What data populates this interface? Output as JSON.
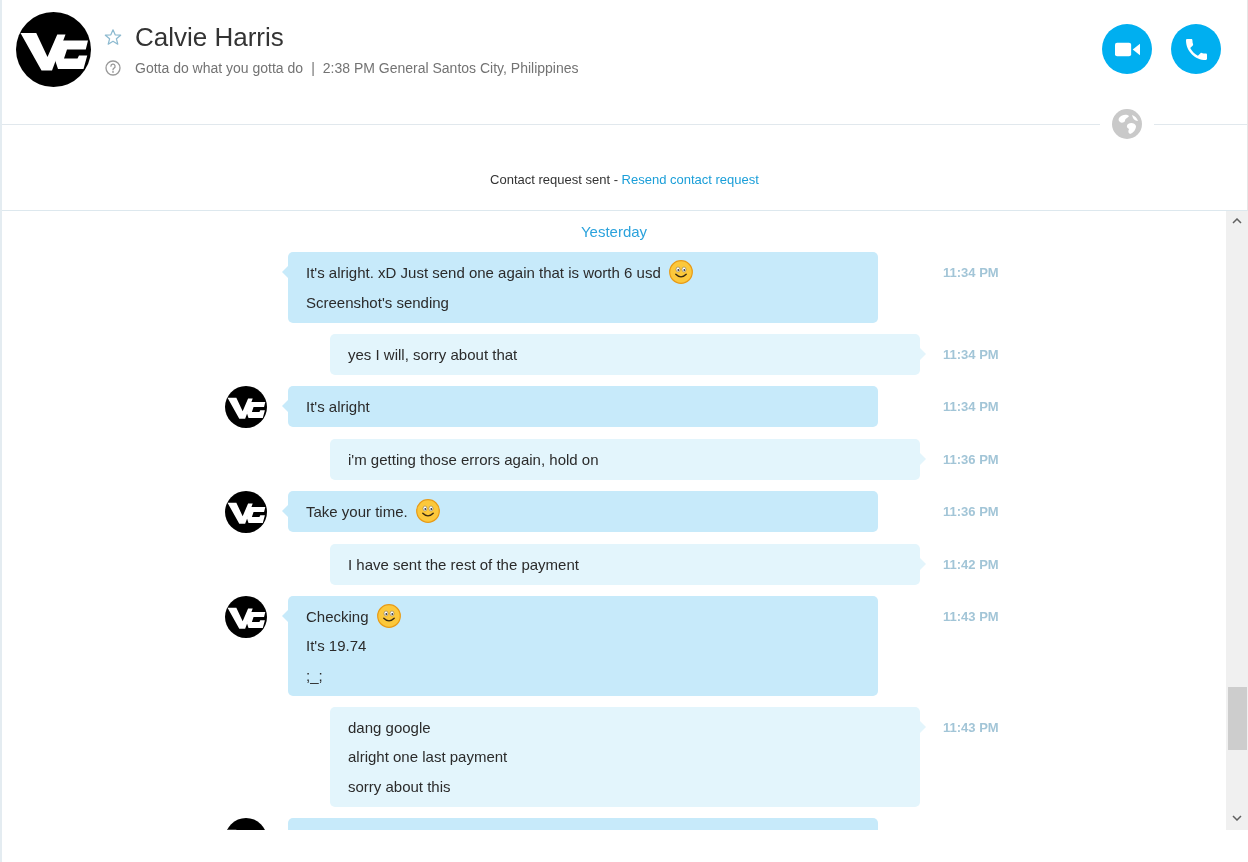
{
  "contact": {
    "name": "Calvie Harris",
    "favorite": false,
    "mood": "Gotta do what you gotta do",
    "separator": "|",
    "local_time": "2:38 PM General Santos City, Philippines"
  },
  "call_buttons": [
    {
      "kind": "video"
    },
    {
      "kind": "voice"
    }
  ],
  "contact_request": {
    "status": "Contact request sent -",
    "link": "Resend contact request"
  },
  "day_label": "Yesterday",
  "messages": [
    {
      "kind": "incoming",
      "show_avatar": false,
      "time": "11:34 PM",
      "lines": [
        {
          "text": "It's alright. xD Just send one again that is worth 6 usd",
          "emoji": true
        },
        {
          "text": "Screenshot's sending",
          "emoji": false
        }
      ]
    },
    {
      "kind": "outgoing",
      "show_avatar": false,
      "time": "11:34 PM",
      "lines": [
        {
          "text": "yes I will, sorry about that",
          "emoji": false
        }
      ]
    },
    {
      "kind": "incoming",
      "show_avatar": true,
      "time": "11:34 PM",
      "lines": [
        {
          "text": "It's alright",
          "emoji": false
        }
      ]
    },
    {
      "kind": "outgoing",
      "show_avatar": false,
      "time": "11:36 PM",
      "lines": [
        {
          "text": "i'm getting those errors again, hold on",
          "emoji": false
        }
      ]
    },
    {
      "kind": "incoming",
      "show_avatar": true,
      "time": "11:36 PM",
      "lines": [
        {
          "text": "Take your time.",
          "emoji": true
        }
      ]
    },
    {
      "kind": "outgoing",
      "show_avatar": false,
      "time": "11:42 PM",
      "lines": [
        {
          "text": "I have sent the rest of the payment",
          "emoji": false
        }
      ]
    },
    {
      "kind": "incoming",
      "show_avatar": true,
      "time": "11:43 PM",
      "lines": [
        {
          "text": "Checking",
          "emoji": true
        },
        {
          "text": "It's 19.74",
          "emoji": false
        },
        {
          "text": ";_;",
          "emoji": false
        }
      ]
    },
    {
      "kind": "outgoing",
      "show_avatar": false,
      "time": "11:43 PM",
      "lines": [
        {
          "text": "dang google",
          "emoji": false
        },
        {
          "text": "alright one last payment",
          "emoji": false
        },
        {
          "text": "sorry about this",
          "emoji": false
        }
      ]
    },
    {
      "kind": "incoming",
      "show_avatar": true
    }
  ]
}
